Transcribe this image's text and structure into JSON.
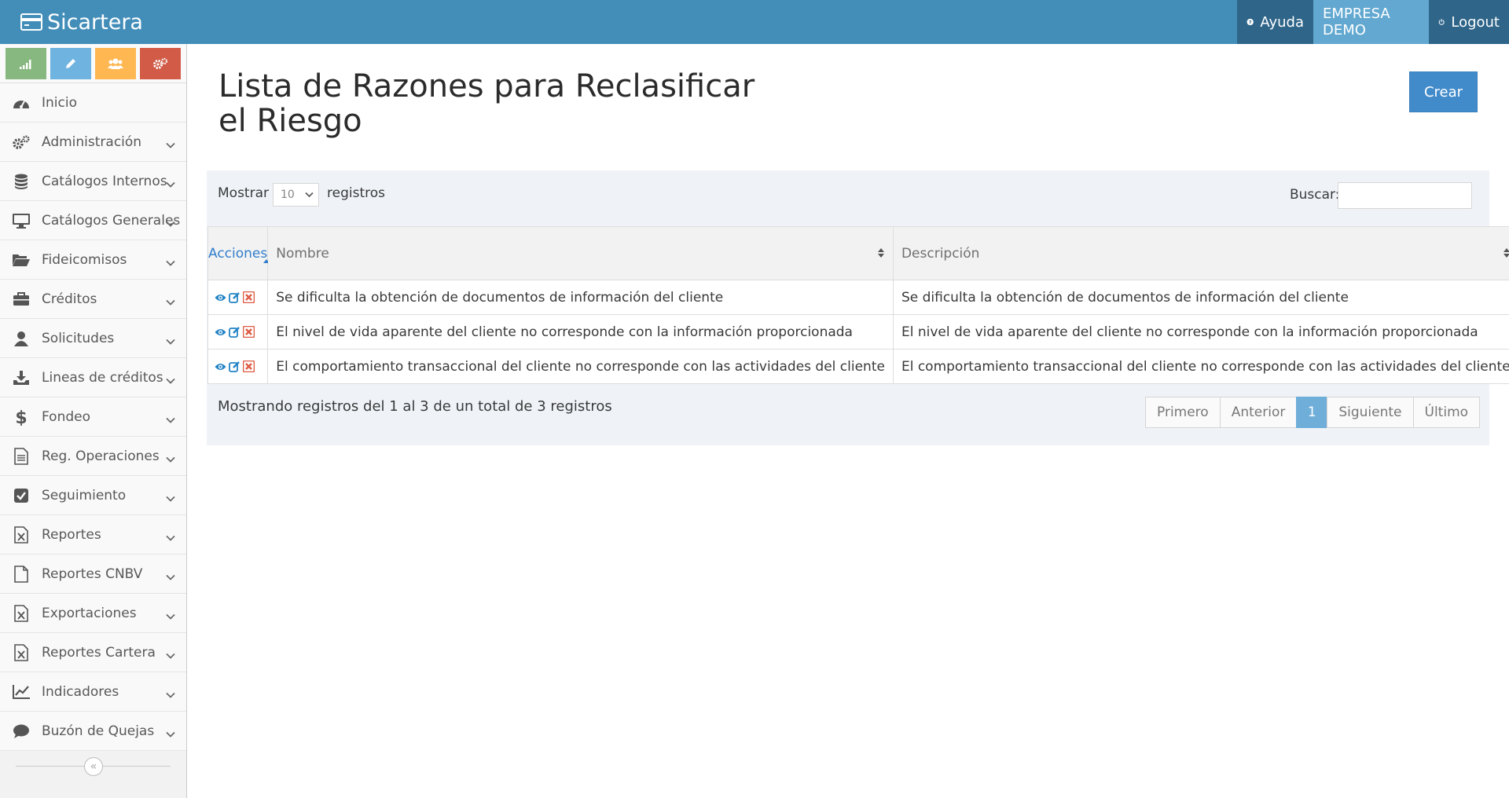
{
  "app": {
    "brand": "Sicartera"
  },
  "nav": {
    "help": "Ayuda",
    "company": "EMPRESA DEMO",
    "logout": "Logout"
  },
  "sidebar": {
    "shortcuts": [
      {
        "icon": "signal-icon",
        "color": "#87b87f"
      },
      {
        "icon": "pencil-icon",
        "color": "#6fb3e0"
      },
      {
        "icon": "users-icon",
        "color": "#ffb752"
      },
      {
        "icon": "cogs-icon",
        "color": "#d15b47"
      }
    ],
    "items": [
      {
        "label": "Inicio",
        "icon": "dashboard-icon"
      },
      {
        "label": "Administración",
        "icon": "cogs-icon"
      },
      {
        "label": "Catálogos Internos",
        "icon": "database-icon"
      },
      {
        "label": "Catálogos Generales",
        "icon": "desktop-icon"
      },
      {
        "label": "Fideicomisos",
        "icon": "folder-open-icon"
      },
      {
        "label": "Créditos",
        "icon": "briefcase-icon"
      },
      {
        "label": "Solicitudes",
        "icon": "user-icon"
      },
      {
        "label": "Lineas de créditos",
        "icon": "download-icon"
      },
      {
        "label": "Fondeo",
        "icon": "dollar-icon"
      },
      {
        "label": "Reg. Operaciones",
        "icon": "file-text-icon"
      },
      {
        "label": "Seguimiento",
        "icon": "check-square-icon"
      },
      {
        "label": "Reportes",
        "icon": "file-excel-icon"
      },
      {
        "label": "Reportes CNBV",
        "icon": "file-icon"
      },
      {
        "label": "Exportaciones",
        "icon": "file-excel-icon"
      },
      {
        "label": "Reportes Cartera",
        "icon": "file-excel-icon"
      },
      {
        "label": "Indicadores",
        "icon": "line-chart-icon"
      },
      {
        "label": "Buzón de Quejas",
        "icon": "comment-icon"
      }
    ],
    "collapse_glyph": "«"
  },
  "main": {
    "title": "Lista de Razones para Reclasificar el Riesgo",
    "create_label": "Crear",
    "table_controls": {
      "show_label": "Mostrar",
      "page_size": "10",
      "records_label": "registros",
      "search_label": "Buscar:"
    },
    "table": {
      "columns": [
        "Acciones",
        "Nombre",
        "Descripción"
      ],
      "rows": [
        {
          "nombre": "Se dificulta la obtención de documentos de información del cliente",
          "descripcion": "Se dificulta la obtención de documentos de información del cliente"
        },
        {
          "nombre": "El nivel de vida aparente del cliente no corresponde con la información proporcionada",
          "descripcion": "El nivel de vida aparente del cliente no corresponde con la información proporcionada"
        },
        {
          "nombre": "El comportamiento transaccional del cliente no corresponde con las actividades del cliente",
          "descripcion": "El comportamiento transaccional del cliente no corresponde con las actividades del cliente"
        }
      ]
    },
    "info": "Mostrando registros del 1 al 3 de un total de 3 registros",
    "pagination": {
      "first": "Primero",
      "prev": "Anterior",
      "current": "1",
      "next": "Siguiente",
      "last": "Último"
    }
  },
  "colors": {
    "navbar": "#438eb9",
    "primary": "#428bca",
    "panel": "#eff3f8",
    "active_page": "#6faed9"
  }
}
